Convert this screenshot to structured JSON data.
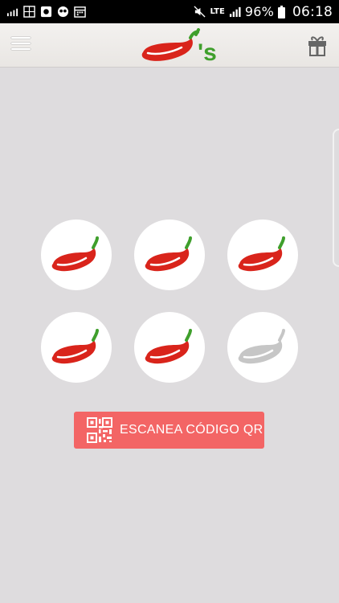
{
  "status_bar": {
    "network_label": "LTE",
    "battery_percent": "96%",
    "time": "06:18"
  },
  "app_bar": {
    "logo_text": "'s"
  },
  "rewards": {
    "collected": 5,
    "total": 6,
    "colors": {
      "active": "#d9241b",
      "inactive": "#c6c6c6",
      "stem_active": "#3f9f2c"
    }
  },
  "scan_button": {
    "label": "ESCANEA CÓDIGO QR",
    "color": "#f36565"
  }
}
